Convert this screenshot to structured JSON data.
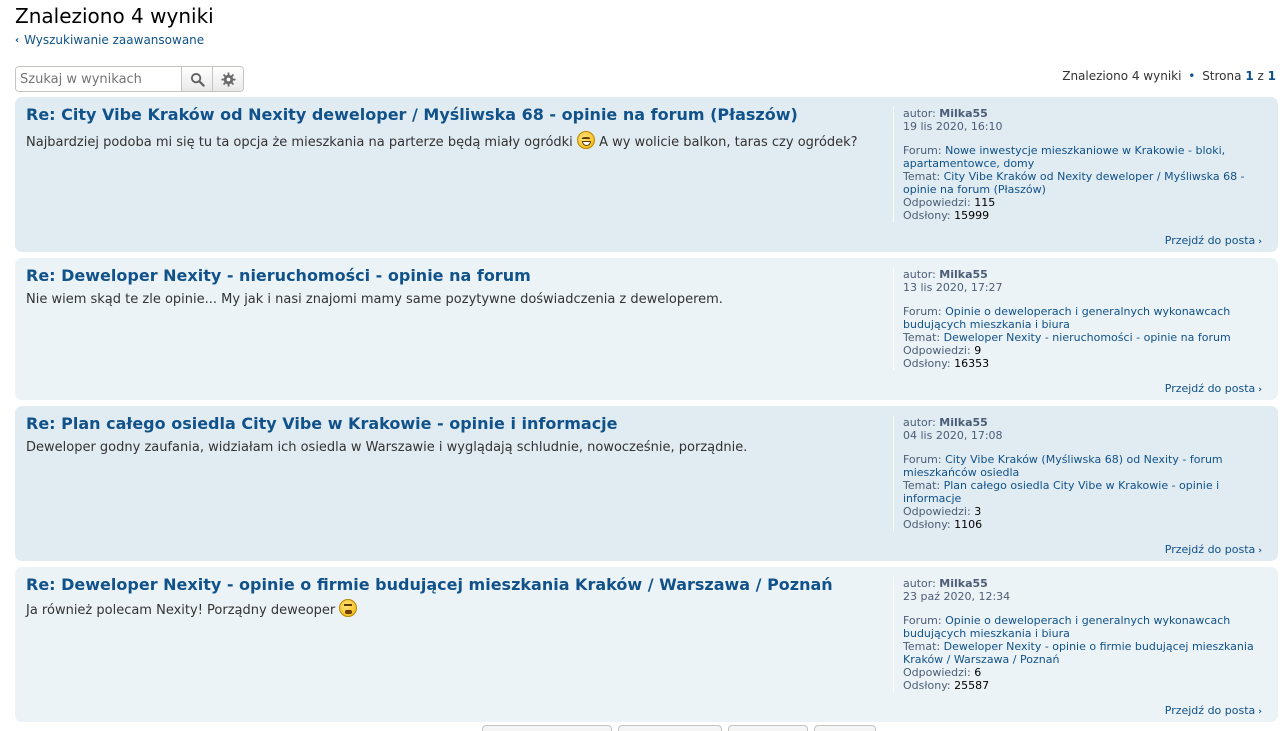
{
  "header": {
    "title": "Znaleziono 4 wyniki",
    "advanced_search": "Wyszukiwanie zaawansowane"
  },
  "search": {
    "placeholder": "Szukaj w wynikach",
    "search_icon": "search-icon",
    "settings_icon": "gear-icon"
  },
  "pagination": {
    "summary": "Znaleziono 4 wyniki",
    "separator": "•",
    "page_label": "Strona",
    "current": "1",
    "of": "z",
    "total": "1"
  },
  "labels": {
    "author": "autor:",
    "forum": "Forum:",
    "topic": "Temat:",
    "replies": "Odpowiedzi:",
    "views": "Odsłony:",
    "jump": "Przejdź do posta"
  },
  "results": [
    {
      "title": "Re: City Vibe Kraków od Nexity deweloper / Myśliwska 68 - opinie na forum (Płaszów)",
      "content_before": "Najbardziej podoba mi się tu ta opcja że mieszkania na parterze będą miały ogródki",
      "content_after": "A wy wolicie balkon, taras czy ogródek?",
      "author": "Milka55",
      "date": "19 lis 2020, 16:10",
      "forum_line1": "Nowe inwestycje mieszkaniowe w Krakowie - bloki,",
      "forum_line2": "apartamentowce, domy",
      "topic_line1": "City Vibe Kraków od Nexity deweloper / Myśliwska 68 -",
      "topic_line2": "opinie na forum (Płaszów)",
      "replies": "115",
      "views": "15999"
    },
    {
      "title": "Re: Deweloper Nexity - nieruchomości - opinie na forum",
      "content_before": "Nie wiem skąd te zle opinie... My jak i nasi znajomi mamy same pozytywne doświadczenia z deweloperem.",
      "content_after": "",
      "author": "Milka55",
      "date": "13 lis 2020, 17:27",
      "forum_line1": "Opinie o deweloperach i generalnych wykonawcach",
      "forum_line2": "budujących mieszkania i biura",
      "topic_line1": "Deweloper Nexity - nieruchomości - opinie na forum",
      "topic_line2": "",
      "replies": "9",
      "views": "16353"
    },
    {
      "title": "Re: Plan całego osiedla City Vibe w Krakowie - opinie i informacje",
      "content_before": "Deweloper godny zaufania, widziałam ich osiedla w Warszawie i wyglądają schludnie, nowocześnie, porządnie.",
      "content_after": "",
      "author": "Milka55",
      "date": "04 lis 2020, 17:08",
      "forum_line1": "City Vibe Kraków (Myśliwska 68) od Nexity - forum",
      "forum_line2": "mieszkańców osiedla",
      "topic_line1": "Plan całego osiedla City Vibe w Krakowie - opinie i",
      "topic_line2": "informacje",
      "replies": "3",
      "views": "1106"
    },
    {
      "title": "Re: Deweloper Nexity - opinie o firmie budującej mieszkania Kraków / Warszawa / Poznań",
      "content_before": "Ja również polecam Nexity! Porządny deweoper",
      "content_after": "",
      "author": "Milka55",
      "date": "23 paź 2020, 12:34",
      "forum_line1": "Opinie o deweloperach i generalnych wykonawcach",
      "forum_line2": "budujących mieszkania i biura",
      "topic_line1": "Deweloper Nexity - opinie o firmie budującej mieszkania",
      "topic_line2": "Kraków / Warszawa / Poznań",
      "replies": "6",
      "views": "25587"
    }
  ]
}
